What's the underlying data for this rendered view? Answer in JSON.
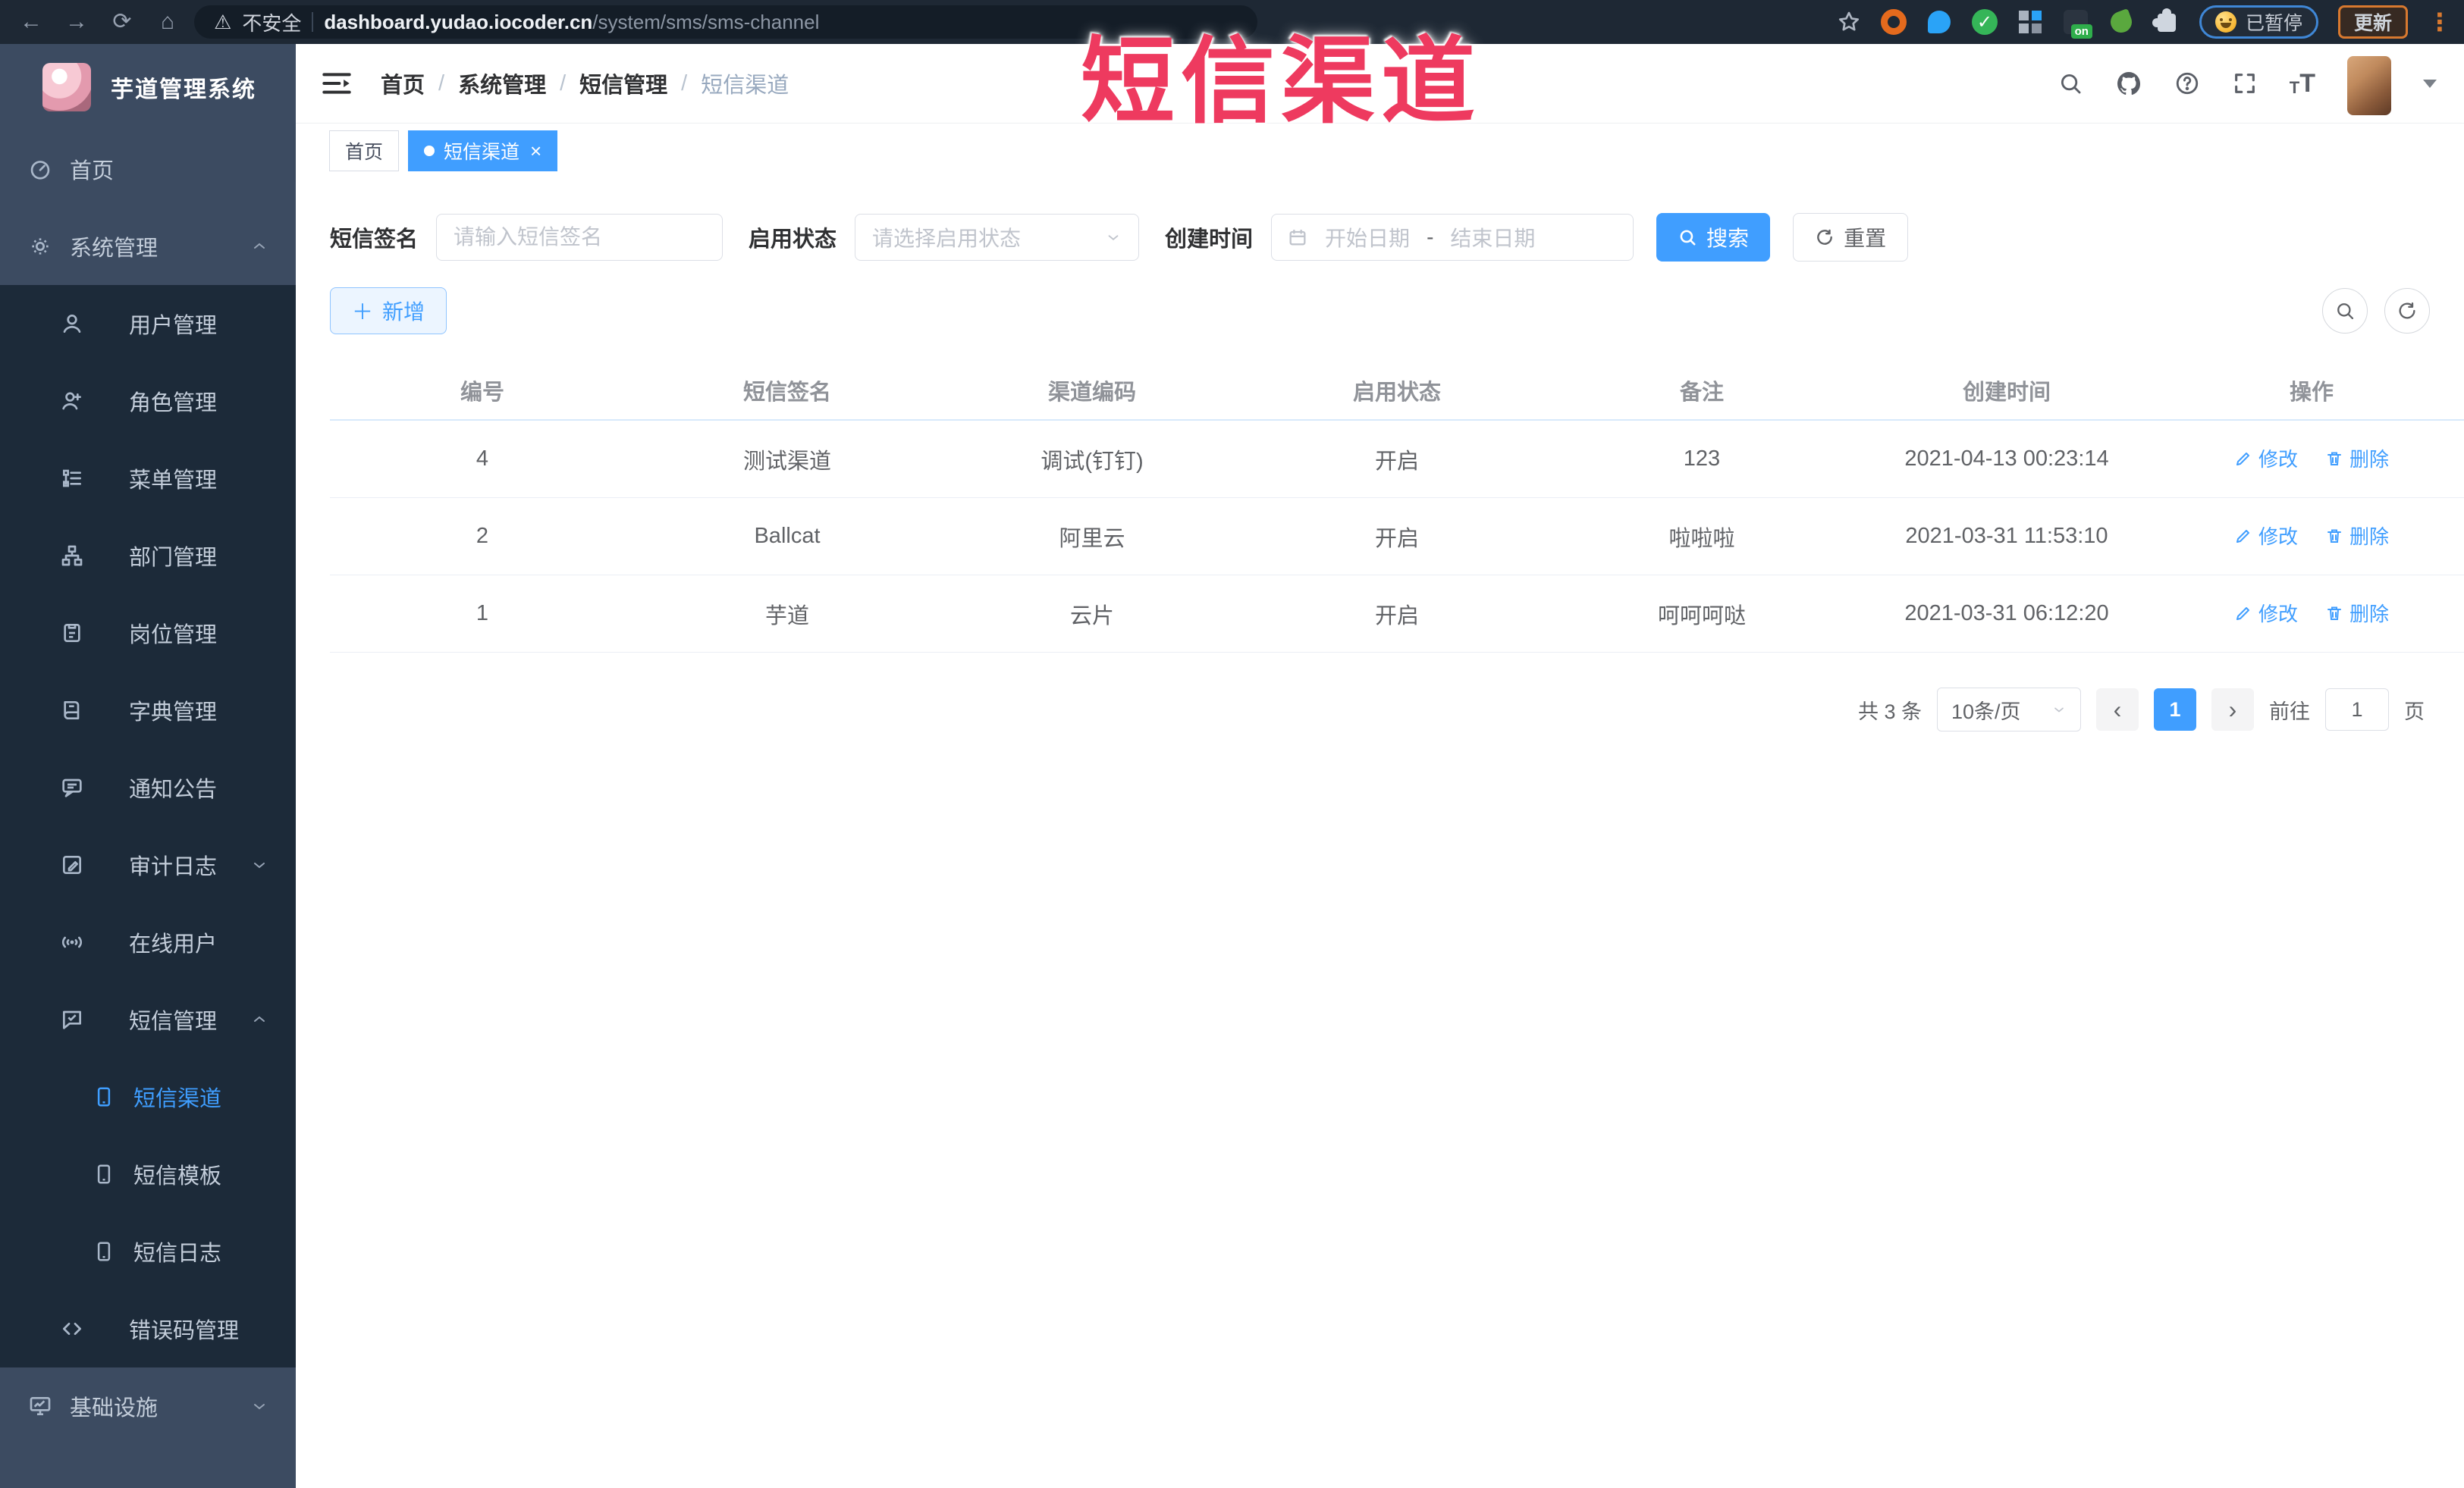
{
  "browser": {
    "toolbar_icons": [
      "back-icon",
      "forward-icon",
      "reload-icon",
      "home-icon"
    ],
    "security_label": "不安全",
    "url": {
      "domain": "dashboard.yudao.iocoder.cn",
      "path": "/system/sms/sms-channel"
    },
    "right_icons": [
      "bookmark-star-icon",
      "ext-orange-ring-icon",
      "ext-blue-drop-icon",
      "ext-green-check-icon",
      "ext-grid-icon",
      "ext-dark-on-icon",
      "ext-green-leaf-icon",
      "ext-puzzle-icon",
      "browser-menu-icon"
    ],
    "ext_badge": "on",
    "paused_chip": {
      "label": "已暂停"
    },
    "update_button": {
      "label": "更新"
    }
  },
  "overlay": {
    "text": "短信渠道",
    "color": "#ee3a5f"
  },
  "sidebar": {
    "logo_title": "芋道管理系统",
    "items": [
      {
        "label": "首页",
        "icon": "dashboard-icon",
        "level": 0
      },
      {
        "label": "系统管理",
        "icon": "gear-icon",
        "level": 0,
        "state": "expanded"
      },
      {
        "label": "用户管理",
        "icon": "user-icon",
        "level": 1
      },
      {
        "label": "角色管理",
        "icon": "role-icon",
        "level": 1
      },
      {
        "label": "菜单管理",
        "icon": "menu-tree-icon",
        "level": 1
      },
      {
        "label": "部门管理",
        "icon": "org-icon",
        "level": 1
      },
      {
        "label": "岗位管理",
        "icon": "badge-icon",
        "level": 1
      },
      {
        "label": "字典管理",
        "icon": "dict-icon",
        "level": 1
      },
      {
        "label": "通知公告",
        "icon": "notice-icon",
        "level": 1
      },
      {
        "label": "审计日志",
        "icon": "audit-icon",
        "level": 1,
        "state": "collapsed"
      },
      {
        "label": "在线用户",
        "icon": "online-icon",
        "level": 1
      },
      {
        "label": "短信管理",
        "icon": "sms-icon",
        "level": 1,
        "state": "expanded"
      },
      {
        "label": "短信渠道",
        "icon": "phone-icon",
        "level": 2,
        "active": true
      },
      {
        "label": "短信模板",
        "icon": "phone-icon",
        "level": 2
      },
      {
        "label": "短信日志",
        "icon": "phone-icon",
        "level": 2
      },
      {
        "label": "错误码管理",
        "icon": "code-icon",
        "level": 1
      },
      {
        "label": "基础设施",
        "icon": "monitor-icon",
        "level": 0,
        "state": "collapsed"
      }
    ]
  },
  "header": {
    "breadcrumb": [
      "首页",
      "系统管理",
      "短信管理",
      "短信渠道"
    ],
    "separator": "/",
    "icons": [
      "search-icon",
      "github-icon",
      "help-icon",
      "fullscreen-icon",
      "font-size-icon",
      "avatar",
      "caret-down-icon"
    ]
  },
  "tabs": [
    {
      "label": "首页",
      "active": false
    },
    {
      "label": "短信渠道",
      "active": true,
      "close": "×"
    }
  ],
  "filters": {
    "sign_label": "短信签名",
    "sign_placeholder": "请输入短信签名",
    "status_label": "启用状态",
    "status_placeholder": "请选择启用状态",
    "time_label": "创建时间",
    "start_placeholder": "开始日期",
    "range_separator": "-",
    "end_placeholder": "结束日期",
    "search_button": "搜索",
    "reset_button": "重置"
  },
  "toolbar": {
    "add_button": "新增",
    "icons": [
      "search-circle-icon",
      "refresh-circle-icon"
    ]
  },
  "table": {
    "headers": [
      "编号",
      "短信签名",
      "渠道编码",
      "启用状态",
      "备注",
      "创建时间",
      "操作"
    ],
    "rows": [
      {
        "id": "4",
        "sign": "测试渠道",
        "code": "调试(钉钉)",
        "status": "开启",
        "remark": "123",
        "created": "2021-04-13 00:23:14"
      },
      {
        "id": "2",
        "sign": "Ballcat",
        "code": "阿里云",
        "status": "开启",
        "remark": "啦啦啦",
        "created": "2021-03-31 11:53:10"
      },
      {
        "id": "1",
        "sign": "芋道",
        "code": "云片",
        "status": "开启",
        "remark": "呵呵呵哒",
        "created": "2021-03-31 06:12:20"
      }
    ],
    "edit_label": "修改",
    "delete_label": "删除"
  },
  "pagination": {
    "total": "共 3 条",
    "page_size": "10条/页",
    "prev": "‹",
    "current_page": "1",
    "next": "›",
    "goto_label": "前往",
    "goto_value": "1",
    "page_label": "页"
  },
  "colors": {
    "accent": "#409eff",
    "overlay_red": "#ee3a5f",
    "sidebar_bg": "#3c4b61",
    "submenu_bg": "#1c2a39"
  }
}
